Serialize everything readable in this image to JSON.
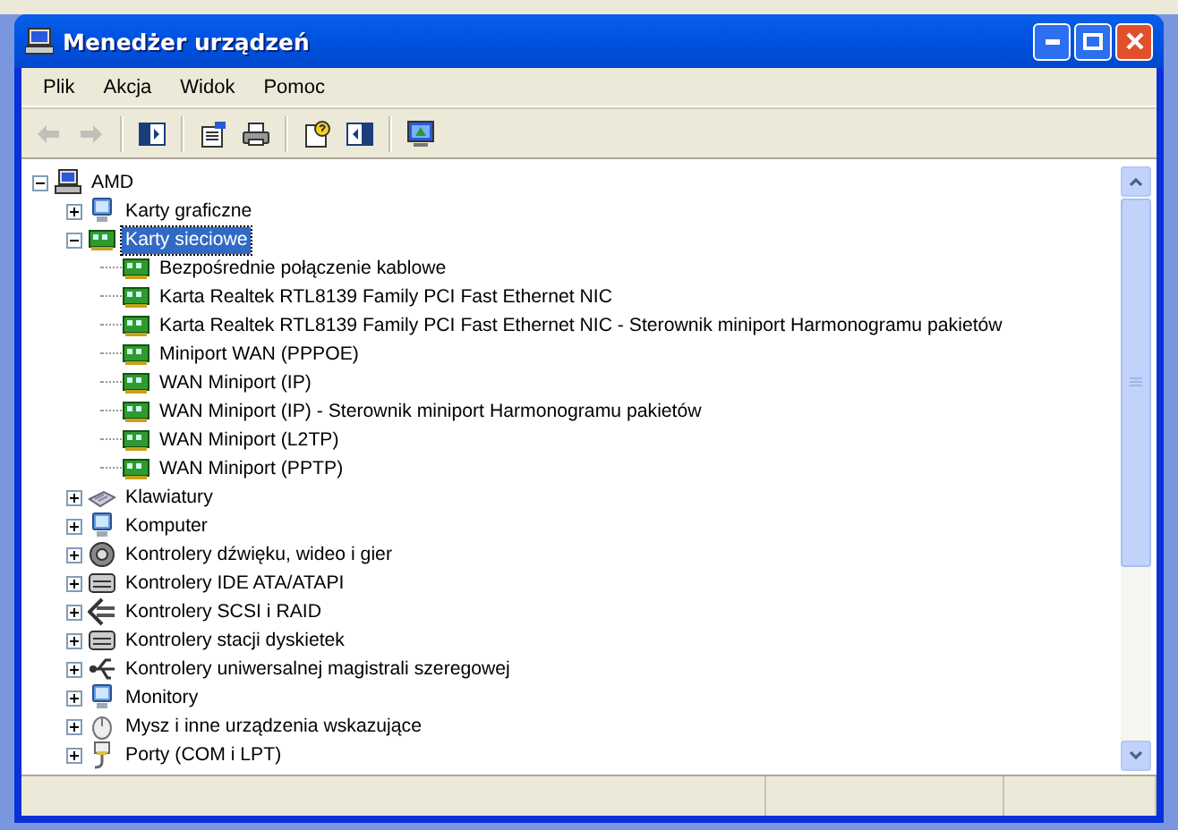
{
  "window": {
    "title": "Menedżer urządzeń"
  },
  "menu": [
    "Plik",
    "Akcja",
    "Widok",
    "Pomoc"
  ],
  "toolbar": [
    {
      "kind": "back",
      "disabled": true
    },
    {
      "kind": "forward",
      "disabled": true
    },
    {
      "kind": "sep"
    },
    {
      "kind": "console",
      "disabled": false
    },
    {
      "kind": "sep"
    },
    {
      "kind": "properties",
      "disabled": false
    },
    {
      "kind": "print",
      "disabled": false
    },
    {
      "kind": "sep"
    },
    {
      "kind": "help",
      "disabled": false
    },
    {
      "kind": "pane",
      "disabled": false
    },
    {
      "kind": "sep"
    },
    {
      "kind": "scan",
      "disabled": false
    }
  ],
  "tree": [
    {
      "label": "AMD",
      "kind": "computer",
      "expanded": true,
      "selected": false,
      "children": [
        {
          "label": "Karty graficzne",
          "kind": "display",
          "expanded": false,
          "selected": false
        },
        {
          "label": "Karty sieciowe",
          "kind": "network",
          "expanded": true,
          "selected": true,
          "children": [
            {
              "label": "Bezpośrednie połączenie kablowe",
              "kind": "network",
              "selected": false
            },
            {
              "label": "Karta Realtek RTL8139 Family PCI Fast Ethernet NIC",
              "kind": "network",
              "selected": false
            },
            {
              "label": "Karta Realtek RTL8139 Family PCI Fast Ethernet NIC - Sterownik miniport Harmonogramu pakietów",
              "kind": "network",
              "selected": false
            },
            {
              "label": "Miniport WAN (PPPOE)",
              "kind": "network",
              "selected": false
            },
            {
              "label": "WAN Miniport (IP)",
              "kind": "network",
              "selected": false
            },
            {
              "label": "WAN Miniport (IP) - Sterownik miniport Harmonogramu pakietów",
              "kind": "network",
              "selected": false
            },
            {
              "label": "WAN Miniport (L2TP)",
              "kind": "network",
              "selected": false
            },
            {
              "label": "WAN Miniport (PPTP)",
              "kind": "network",
              "selected": false
            }
          ]
        },
        {
          "label": "Klawiatury",
          "kind": "keyboard",
          "expanded": false,
          "selected": false
        },
        {
          "label": "Komputer",
          "kind": "display",
          "expanded": false,
          "selected": false
        },
        {
          "label": "Kontrolery dźwięku, wideo i gier",
          "kind": "speaker",
          "expanded": false,
          "selected": false
        },
        {
          "label": "Kontrolery IDE ATA/ATAPI",
          "kind": "drive",
          "expanded": false,
          "selected": false
        },
        {
          "label": "Kontrolery SCSI i RAID",
          "kind": "scsi",
          "expanded": false,
          "selected": false
        },
        {
          "label": "Kontrolery stacji dyskietek",
          "kind": "drive",
          "expanded": false,
          "selected": false
        },
        {
          "label": "Kontrolery uniwersalnej magistrali szeregowej",
          "kind": "usb",
          "expanded": false,
          "selected": false
        },
        {
          "label": "Monitory",
          "kind": "display",
          "expanded": false,
          "selected": false
        },
        {
          "label": "Mysz i inne urządzenia wskazujące",
          "kind": "mouse",
          "expanded": false,
          "selected": false
        },
        {
          "label": "Porty (COM i LPT)",
          "kind": "port",
          "expanded": false,
          "selected": false
        }
      ]
    }
  ]
}
